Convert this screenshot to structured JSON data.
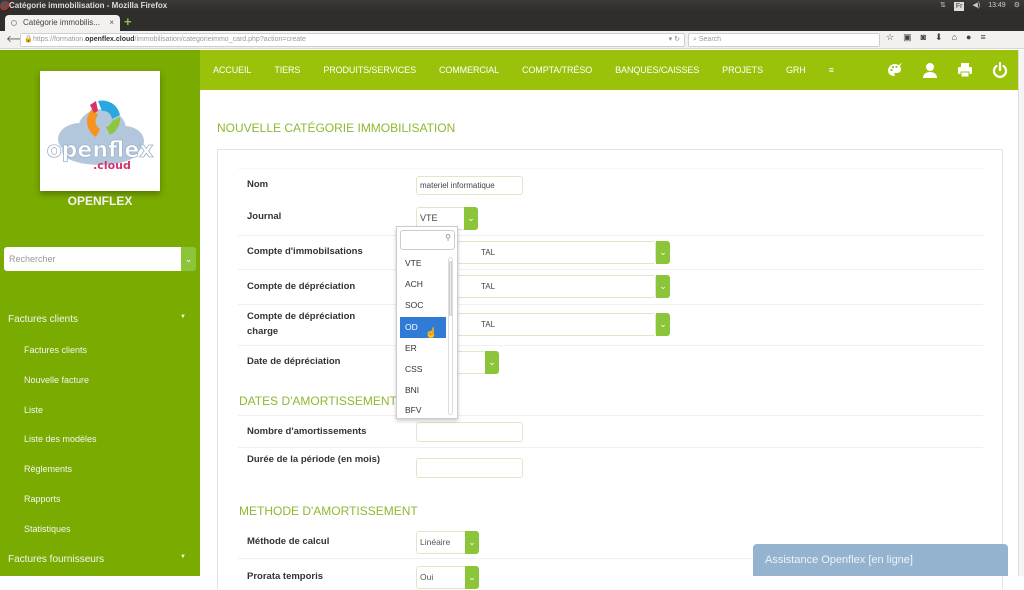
{
  "os": {
    "window_title": "Catégorie immobilisation - Mozilla Firefox",
    "keyboard_lang": "Fr",
    "clock": "13:49"
  },
  "browser": {
    "tab_title": "Catégorie immobilis...",
    "tab_close": "×",
    "new_tab": "+",
    "url_prefix": "https://formation.",
    "url_domain": "openflex.cloud",
    "url_path": "/immobilisation/categorieimmo_card.php?action=create",
    "search_placeholder": "Search",
    "toolbar_icons": [
      "star-icon",
      "clipboard-icon",
      "pocket-icon",
      "download-icon",
      "home-icon",
      "chat-icon",
      "menu-icon"
    ]
  },
  "sidebar": {
    "brand": "OPENFLEX",
    "logo_text": "openflex",
    "logo_sub": ".cloud",
    "search_placeholder": "Rechercher",
    "sections": [
      {
        "label": "Factures clients",
        "items": [
          "Factures clients",
          "Nouvelle facture",
          "Liste",
          "Liste des modèles",
          "Règlements",
          "Rapports",
          "Statistiques"
        ]
      },
      {
        "label": "Factures fournisseurs",
        "items": []
      }
    ]
  },
  "topmenu": {
    "items": [
      "ACCUEIL",
      "TIERS",
      "PRODUITS/SERVICES",
      "COMMERCIAL",
      "COMPTA/TRÉSO",
      "BANQUES/CAISSES",
      "PROJETS",
      "GRH"
    ],
    "right_icons": [
      "palette-icon",
      "user-icon",
      "print-icon",
      "power-icon"
    ]
  },
  "main": {
    "title": "NOUVELLE CATÉGORIE IMMOBILISATION",
    "fields": {
      "nom": {
        "label": "Nom",
        "value": "materiel informatique"
      },
      "journal": {
        "label": "Journal",
        "value": "VTE"
      },
      "compte_immo": {
        "label": "Compte d'immobilsations",
        "value": "TAL"
      },
      "compte_dep": {
        "label": "Compte de dépréciation",
        "value": "TAL"
      },
      "compte_dep_charge": {
        "label": "Compte de dépréciation charge",
        "value": "TAL"
      },
      "date_dep": {
        "label": "Date de dépréciation",
        "value": ""
      }
    },
    "section_dates": "DATES D'AMORTISSEMENT",
    "nb_amort": {
      "label": "Nombre d'amortissements",
      "value": ""
    },
    "duree": {
      "label": "Durée de la période (en mois)",
      "value": ""
    },
    "section_methode": "METHODE D'AMORTISSEMENT",
    "methode": {
      "label": "Méthode de calcul",
      "value": "Linéaire"
    },
    "prorata": {
      "label": "Prorata temporis",
      "value": "Oui"
    }
  },
  "dropdown": {
    "options": [
      "VTE",
      "ACH",
      "SOC",
      "OD",
      "ER",
      "CSS",
      "BNI",
      "BFV"
    ],
    "highlighted": "OD"
  },
  "chat": {
    "label": "Assistance Openflex [en ligne]"
  }
}
